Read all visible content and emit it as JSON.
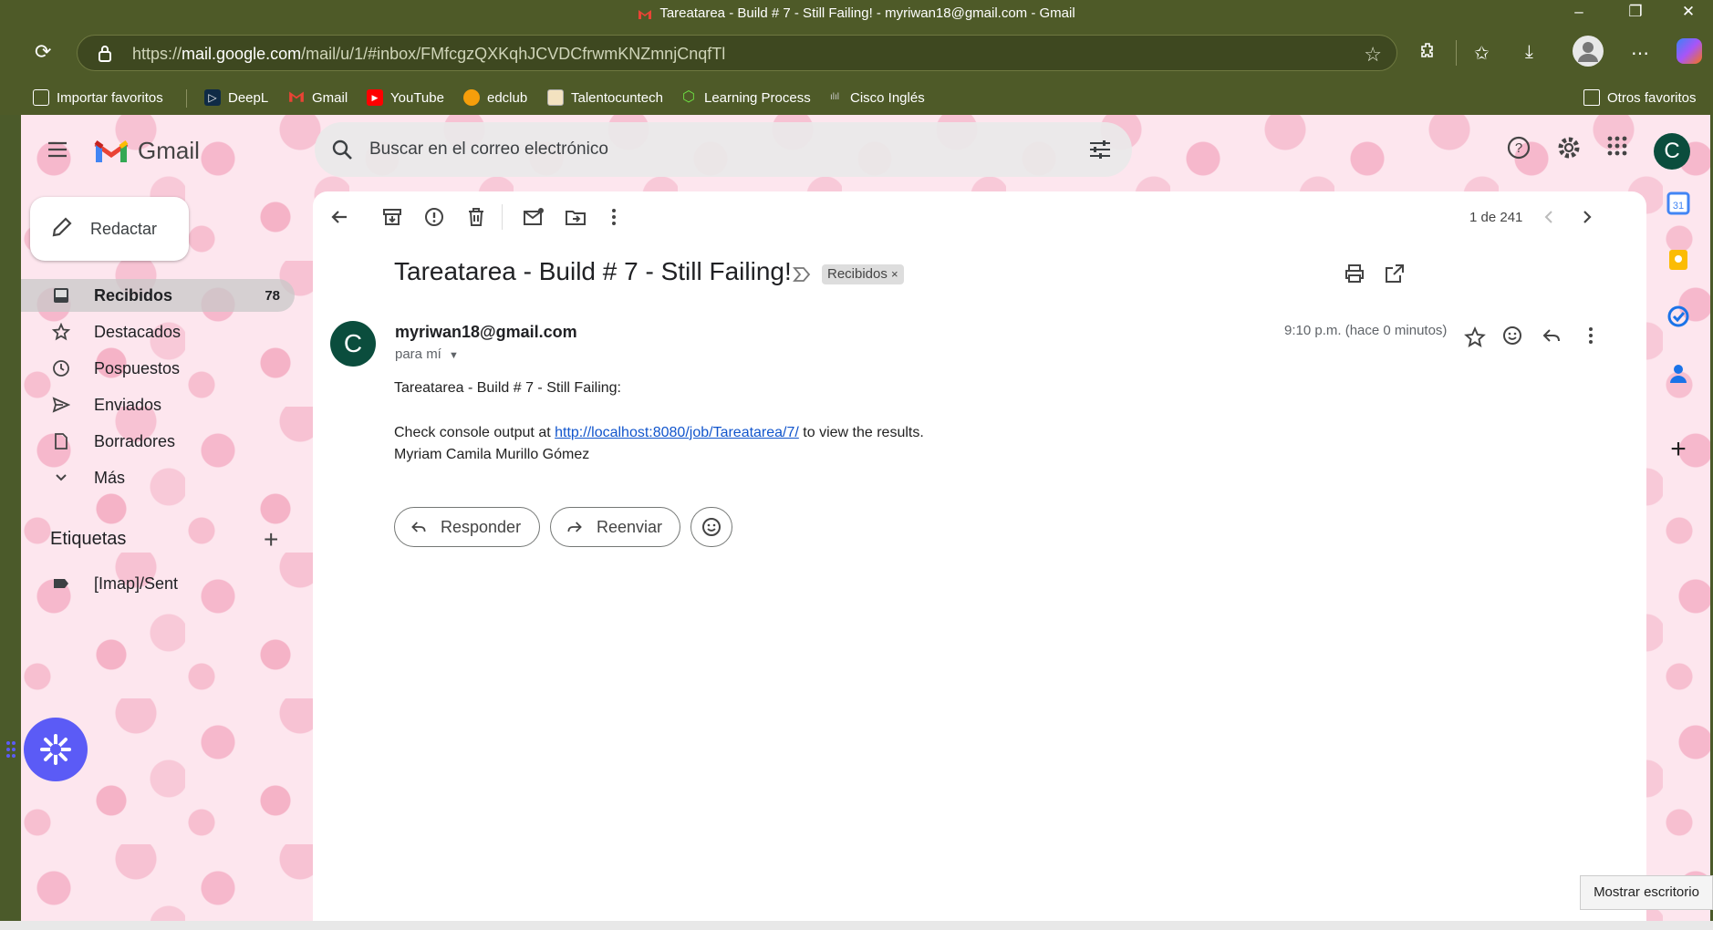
{
  "window": {
    "title": "Tareatarea - Build # 7 - Still Failing! - myriwan18@gmail.com - Gmail"
  },
  "browser": {
    "url_prefix": "https://",
    "url_host": "mail.google.com",
    "url_path": "/mail/u/1/#inbox/FMfcgzQXKqhJCVDCfrwmKNZmnjCnqfTl"
  },
  "bookmarks": [
    {
      "label": "Importar favoritos",
      "icon": "import-icon"
    },
    {
      "label": "DeepL",
      "icon": "deepl-icon"
    },
    {
      "label": "Gmail",
      "icon": "gmail-icon"
    },
    {
      "label": "YouTube",
      "icon": "youtube-icon"
    },
    {
      "label": "edclub",
      "icon": "edclub-icon"
    },
    {
      "label": "Talentocuntech",
      "icon": "talento-icon"
    },
    {
      "label": "Learning Process",
      "icon": "learning-icon"
    },
    {
      "label": "Cisco Inglés",
      "icon": "cisco-icon"
    }
  ],
  "other_bookmarks": "Otros favoritos",
  "gmail": {
    "brand": "Gmail",
    "search_placeholder": "Buscar en el correo electrónico",
    "account_initial": "C",
    "compose": "Redactar",
    "nav": [
      {
        "label": "Recibidos",
        "count": "78",
        "icon": "inbox-icon"
      },
      {
        "label": "Destacados",
        "count": "",
        "icon": "star-icon"
      },
      {
        "label": "Pospuestos",
        "count": "",
        "icon": "clock-icon"
      },
      {
        "label": "Enviados",
        "count": "",
        "icon": "send-icon"
      },
      {
        "label": "Borradores",
        "count": "",
        "icon": "draft-icon"
      },
      {
        "label": "Más",
        "count": "",
        "icon": "chevron-down-icon"
      }
    ],
    "labels_heading": "Etiquetas",
    "labels": [
      {
        "label": "[Imap]/Sent"
      }
    ]
  },
  "email": {
    "pager": "1 de 241",
    "subject": "Tareatarea - Build # 7 - Still Failing!",
    "label_chip": "Recibidos",
    "sender_initial": "C",
    "sender": "myriwan18@gmail.com",
    "to": "para mí",
    "time": "9:10 p.m. (hace 0 minutos)",
    "body_line1": "Tareatarea - Build # 7 - Still Failing:",
    "body_line2_prefix": "Check console output at ",
    "body_link": "http://localhost:8080/job/Tareatarea/7/",
    "body_line2_suffix": " to view the results.",
    "body_line3": "Myriam Camila Murillo Gómez",
    "reply": "Responder",
    "forward": "Reenviar"
  },
  "taskbar_tooltip": "Mostrar escritorio",
  "colors": {
    "accent": "#0b4d3d",
    "chrome": "#4e5a28",
    "link": "#1155cc",
    "gemini": "#5b5bf6"
  }
}
